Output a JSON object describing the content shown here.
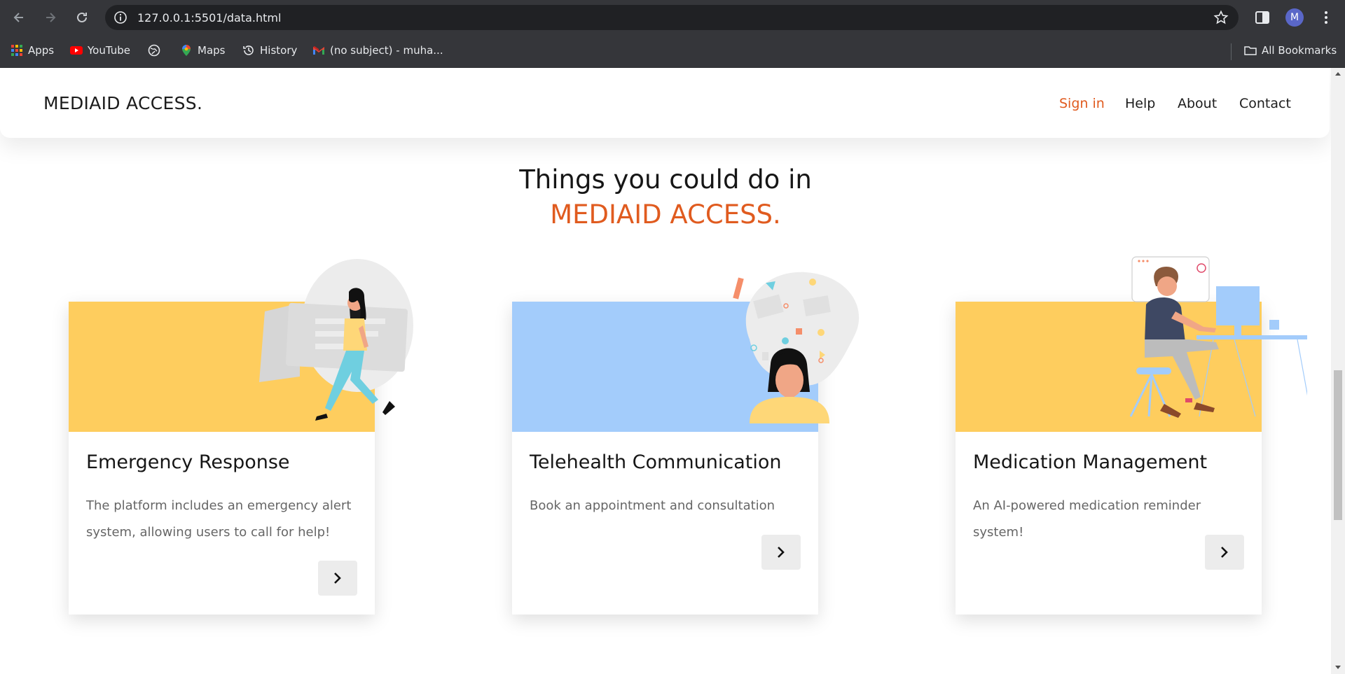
{
  "browser": {
    "url": "127.0.0.1:5501/data.html",
    "profile_initial": "M",
    "bookmarks": [
      {
        "label": "Apps",
        "icon": "apps-grid-icon"
      },
      {
        "label": "YouTube",
        "icon": "youtube-icon"
      },
      {
        "label": "",
        "icon": "globe-icon"
      },
      {
        "label": "Maps",
        "icon": "maps-pin-icon"
      },
      {
        "label": "History",
        "icon": "history-icon"
      },
      {
        "label": "(no subject) - muha...",
        "icon": "gmail-icon"
      }
    ],
    "all_bookmarks_label": "All Bookmarks"
  },
  "site": {
    "logo": "MEDIAID ACCESS.",
    "nav": [
      {
        "label": "Sign in",
        "active": true
      },
      {
        "label": "Help",
        "active": false
      },
      {
        "label": "About",
        "active": false
      },
      {
        "label": "Contact",
        "active": false
      }
    ],
    "headline_line1": "Things you could do in",
    "headline_line2": "MEDIAID ACCESS."
  },
  "cards": [
    {
      "title": "Emergency Response",
      "description": "The platform includes an emergency alert system, allowing users to call for help!",
      "banner_color": "#fecd5e",
      "illustration": "woman-walking-with-ticket-illustration"
    },
    {
      "title": "Telehealth Communication",
      "description": "Book an appointment and consultation",
      "banner_color": "#a3ccfb",
      "illustration": "woman-with-ideas-illustration"
    },
    {
      "title": "Medication Management",
      "description": "An AI-powered medication reminder system!",
      "banner_color": "#fecd5e",
      "illustration": "man-at-computer-desk-illustration"
    }
  ],
  "colors": {
    "accent": "#e05b1f",
    "chrome_bg": "#35363a",
    "omnibox_bg": "#202124"
  }
}
